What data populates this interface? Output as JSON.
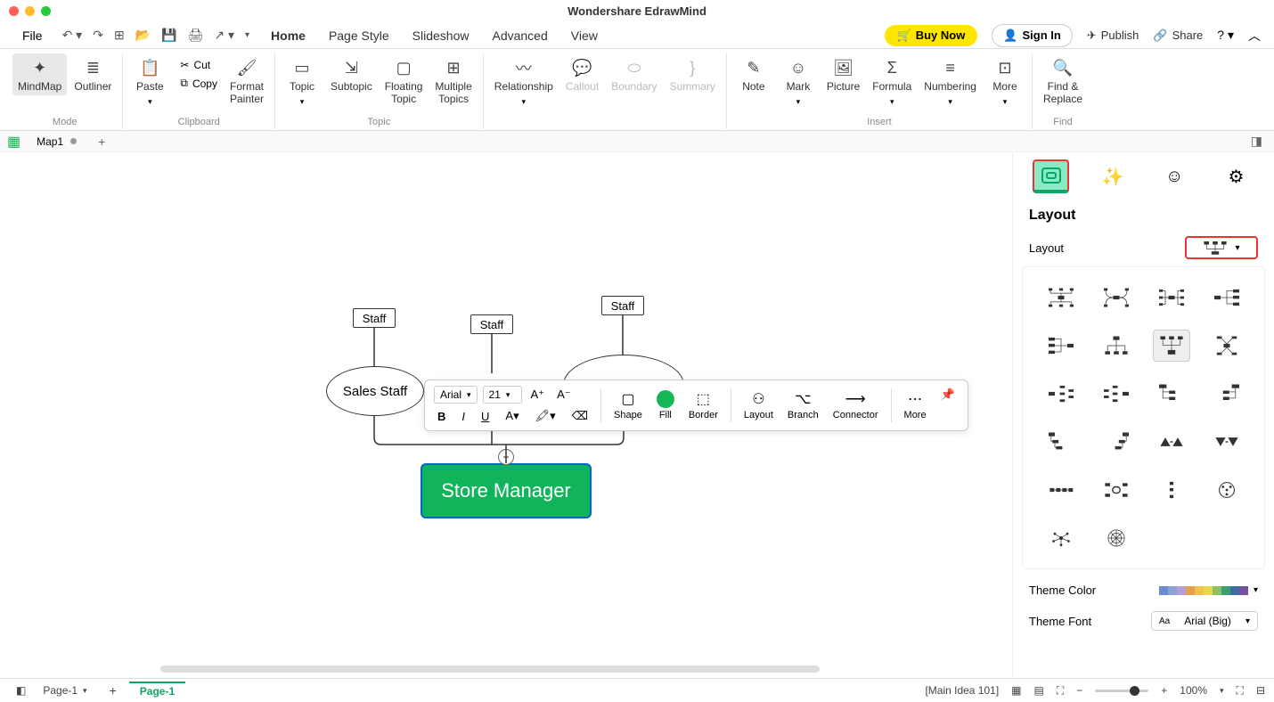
{
  "window": {
    "title": "Wondershare EdrawMind"
  },
  "menu": {
    "file": "File",
    "tabs": [
      "Home",
      "Page Style",
      "Slideshow",
      "Advanced",
      "View"
    ],
    "active_tab": "Home",
    "buy_now": "Buy Now",
    "sign_in": "Sign In",
    "publish": "Publish",
    "share": "Share"
  },
  "ribbon": {
    "mode": {
      "label": "Mode",
      "mindmap": "MindMap",
      "outliner": "Outliner"
    },
    "clipboard": {
      "label": "Clipboard",
      "paste": "Paste",
      "cut": "Cut",
      "copy": "Copy",
      "format_painter": "Format\nPainter"
    },
    "topic": {
      "label": "Topic",
      "topic": "Topic",
      "subtopic": "Subtopic",
      "floating": "Floating\nTopic",
      "multiple": "Multiple\nTopics"
    },
    "relations": {
      "relationship": "Relationship",
      "callout": "Callout",
      "boundary": "Boundary",
      "summary": "Summary"
    },
    "insert": {
      "label": "Insert",
      "note": "Note",
      "mark": "Mark",
      "picture": "Picture",
      "formula": "Formula",
      "numbering": "Numbering",
      "more": "More"
    },
    "find": {
      "label": "Find",
      "find_replace": "Find &\nReplace"
    }
  },
  "doc_tabs": {
    "tab1": "Map1"
  },
  "canvas": {
    "staff1": "Staff",
    "staff2": "Staff",
    "staff3": "Staff",
    "sales_staff": "Sales Staff",
    "store_manager": "Store Manager"
  },
  "float_toolbar": {
    "font": "Arial",
    "size": "21",
    "shape": "Shape",
    "fill": "Fill",
    "border": "Border",
    "layout": "Layout",
    "branch": "Branch",
    "connector": "Connector",
    "more": "More"
  },
  "panel": {
    "section_title": "Layout",
    "layout_label": "Layout",
    "theme_color_label": "Theme Color",
    "theme_font_label": "Theme Font",
    "theme_font_value": "Arial (Big)",
    "theme_colors": [
      "#6b8cce",
      "#8ba3d4",
      "#b4a0d8",
      "#e8a04a",
      "#f0c050",
      "#e8d850",
      "#8cc060",
      "#3aa070",
      "#3a70a0",
      "#7850a0"
    ]
  },
  "status": {
    "page_label": "Page-1",
    "active_page": "Page-1",
    "main_idea": "[Main Idea 101]",
    "zoom": "100%"
  }
}
